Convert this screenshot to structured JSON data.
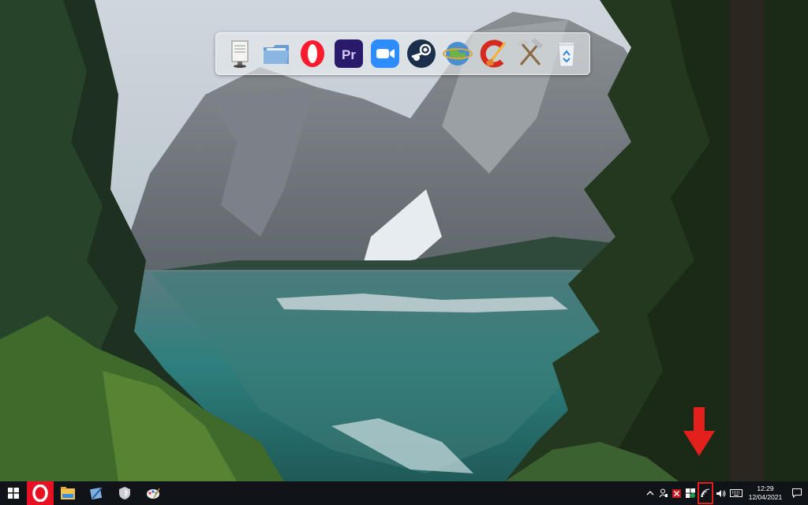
{
  "desktop": {
    "wallpaper": "lake-mountains-forest"
  },
  "dock": {
    "items": [
      {
        "name": "preview-app",
        "icon": "preview-icon"
      },
      {
        "name": "files-app",
        "icon": "folder-files-icon"
      },
      {
        "name": "opera-browser",
        "icon": "opera-icon",
        "color": "#ff1b2d"
      },
      {
        "name": "premiere-pro",
        "icon": "premiere-pro-icon",
        "label": "Pr",
        "color": "#2a1a6b"
      },
      {
        "name": "zoom",
        "icon": "zoom-icon",
        "color": "#2d8cff"
      },
      {
        "name": "steam",
        "icon": "steam-icon",
        "color": "#1b2f4c"
      },
      {
        "name": "network-globe",
        "icon": "globe-icon"
      },
      {
        "name": "ccleaner",
        "icon": "ccleaner-icon",
        "color": "#d52b1e"
      },
      {
        "name": "system-tools",
        "icon": "hammer-pick-icon"
      },
      {
        "name": "recycle-bin",
        "icon": "recycle-bin-icon"
      }
    ]
  },
  "taskbar": {
    "start_icon": "windows-icon",
    "pinned": [
      {
        "name": "opera-gx",
        "icon": "opera-icon",
        "active": true
      },
      {
        "name": "file-explorer",
        "icon": "file-explorer-icon"
      },
      {
        "name": "edit-app",
        "icon": "pen-app-icon"
      },
      {
        "name": "shield-app",
        "icon": "shield-icon"
      },
      {
        "name": "paint-app",
        "icon": "paint-palette-icon"
      }
    ],
    "tray": {
      "overflow_icon": "chevron-up-icon",
      "icons": [
        "person-icon",
        "red-x-icon",
        "defender-icon",
        "wifi-icon",
        "volume-icon",
        "keyboard-icon"
      ],
      "time": "12:29",
      "date": "12/04/2021",
      "notification_icon": "action-center-icon"
    }
  },
  "annotation": {
    "arrow_color": "#e3201b",
    "highlight": "wifi-icon"
  }
}
